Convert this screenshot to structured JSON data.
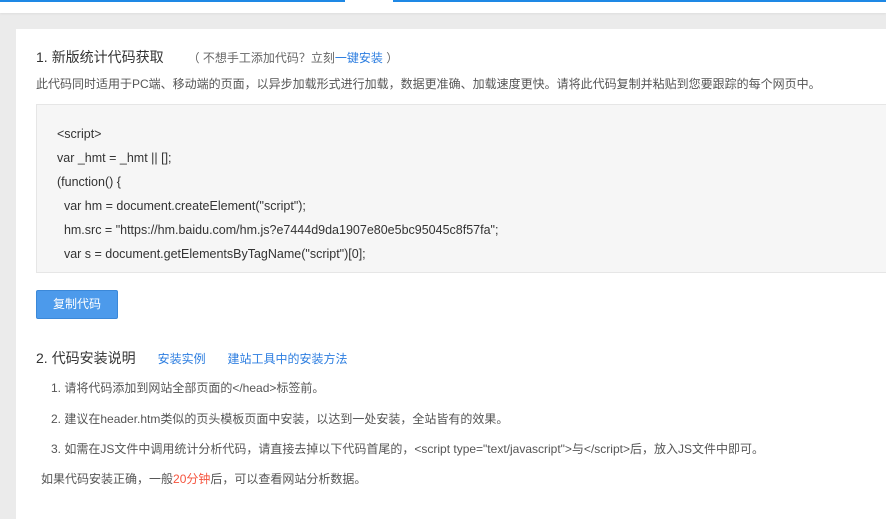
{
  "section1": {
    "number": "1.",
    "title": "新版统计代码获取",
    "hint_prefix": "（ 不想手工添加代码？立刻",
    "hint_link": "一键安装",
    "hint_suffix": " ）",
    "description": "此代码同时适用于PC端、移动端的页面，以异步加载形式进行加载，数据更准确、加载速度更快。请将此代码复制并粘贴到您要跟踪的每个网页中。",
    "code_lines": [
      "<script>",
      "var _hmt = _hmt || [];",
      "(function() {",
      "  var hm = document.createElement(\"script\");",
      "  hm.src = \"https://hm.baidu.com/hm.js?e7444d9da1907e80e5bc95045c8f57fa\";",
      "  var s = document.getElementsByTagName(\"script\")[0];"
    ],
    "copy_button": "复制代码"
  },
  "section2": {
    "number": "2.",
    "title": "代码安装说明",
    "link1": "安装实例",
    "link2": "建站工具中的安装方法",
    "steps": [
      "1. 请将代码添加到网站全部页面的</head>标签前。",
      "2. 建议在header.htm类似的页头模板页面中安装，以达到一处安装，全站皆有的效果。",
      "3. 如需在JS文件中调用统计分析代码，请直接去掉以下代码首尾的，<script type=\"text/javascript\">与</script>后，放入JS文件中即可。"
    ],
    "note_prefix": "如果代码安装正确，一般",
    "note_highlight": "20分钟",
    "note_suffix": "后，可以查看网站分析数据。"
  },
  "colors": {
    "accent": "#2d7ee0",
    "button": "#4c9aeb",
    "highlight": "#f5533d"
  }
}
